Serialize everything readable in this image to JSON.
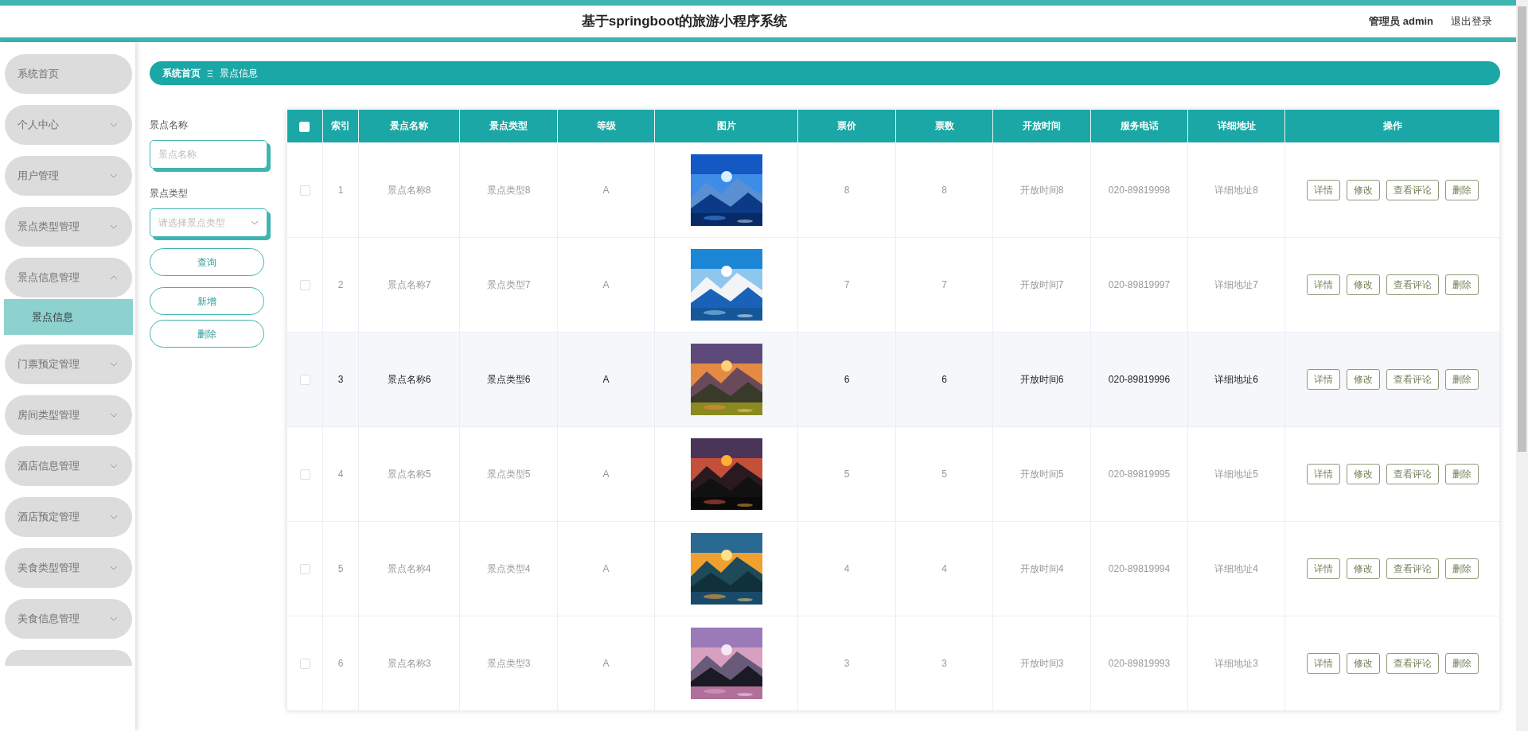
{
  "header": {
    "title": "基于springboot的旅游小程序系统",
    "user_role": "管理员",
    "user_name": "admin",
    "logout": "退出登录"
  },
  "sidebar": {
    "items": [
      {
        "label": "系统首页"
      },
      {
        "label": "个人中心",
        "expanded": false
      },
      {
        "label": "用户管理",
        "expanded": false
      },
      {
        "label": "景点类型管理",
        "expanded": false
      },
      {
        "label": "景点信息管理",
        "expanded": true,
        "children": [
          {
            "label": "景点信息",
            "selected": true
          }
        ]
      },
      {
        "label": "门票预定管理",
        "expanded": false
      },
      {
        "label": "房间类型管理",
        "expanded": false
      },
      {
        "label": "酒店信息管理",
        "expanded": false
      },
      {
        "label": "酒店预定管理",
        "expanded": false
      },
      {
        "label": "美食类型管理",
        "expanded": false
      },
      {
        "label": "美食信息管理",
        "expanded": false
      }
    ]
  },
  "breadcrumb": [
    "系统首页",
    "景点信息"
  ],
  "search": {
    "fields": [
      {
        "kind": "text",
        "label": "景点名称",
        "placeholder": "景点名称"
      },
      {
        "kind": "select",
        "label": "景点类型",
        "placeholder": "请选择景点类型"
      }
    ],
    "buttons": [
      "查询",
      "新增",
      "删除"
    ]
  },
  "table": {
    "select_all_checked": false,
    "columns": [
      "索引",
      "景点名称",
      "景点类型",
      "等级",
      "图片",
      "票价",
      "票数",
      "开放时间",
      "服务电话",
      "详细地址",
      "操作"
    ],
    "rows": [
      {
        "checked": false,
        "hovered": false,
        "index": "1",
        "name": "景点名称8",
        "type": "景点类型8",
        "grade": "A",
        "price": "8",
        "count": "8",
        "open_time": "开放时间8",
        "phone": "020-89819998",
        "address": "详细地址8",
        "actions": [
          "详情",
          "修改",
          "查看评论",
          "删除"
        ]
      },
      {
        "checked": false,
        "hovered": false,
        "index": "2",
        "name": "景点名称7",
        "type": "景点类型7",
        "grade": "A",
        "price": "7",
        "count": "7",
        "open_time": "开放时间7",
        "phone": "020-89819997",
        "address": "详细地址7",
        "actions": [
          "详情",
          "修改",
          "查看评论",
          "删除"
        ]
      },
      {
        "checked": false,
        "hovered": true,
        "index": "3",
        "name": "景点名称6",
        "type": "景点类型6",
        "grade": "A",
        "price": "6",
        "count": "6",
        "open_time": "开放时间6",
        "phone": "020-89819996",
        "address": "详细地址6",
        "actions": [
          "详情",
          "修改",
          "查看评论",
          "删除"
        ]
      },
      {
        "checked": false,
        "hovered": false,
        "index": "4",
        "name": "景点名称5",
        "type": "景点类型5",
        "grade": "A",
        "price": "5",
        "count": "5",
        "open_time": "开放时间5",
        "phone": "020-89819995",
        "address": "详细地址5",
        "actions": [
          "详情",
          "修改",
          "查看评论",
          "删除"
        ]
      },
      {
        "checked": false,
        "hovered": false,
        "index": "5",
        "name": "景点名称4",
        "type": "景点类型4",
        "grade": "A",
        "price": "4",
        "count": "4",
        "open_time": "开放时间4",
        "phone": "020-89819994",
        "address": "详细地址4",
        "actions": [
          "详情",
          "修改",
          "查看评论",
          "删除"
        ]
      },
      {
        "checked": false,
        "hovered": false,
        "index": "6",
        "name": "景点名称3",
        "type": "景点类型3",
        "grade": "A",
        "price": "3",
        "count": "3",
        "open_time": "开放时间3",
        "phone": "020-89819993",
        "address": "详细地址3",
        "actions": [
          "详情",
          "修改",
          "查看评论",
          "删除"
        ]
      }
    ]
  }
}
